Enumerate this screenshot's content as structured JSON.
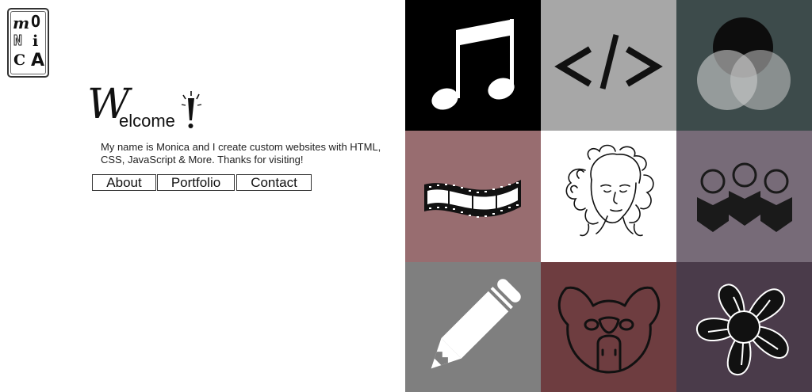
{
  "logo": {
    "letters": [
      "m",
      "O",
      "N",
      "i",
      "C",
      "A"
    ],
    "alt": "MONICA"
  },
  "welcome": {
    "big_letter": "W",
    "rest": "elcome"
  },
  "intro_text": "My name is Monica and I create custom websites with HTML, CSS, JavaScript & More. Thanks for visiting!",
  "nav": {
    "about": "About",
    "portfolio": "Portfolio",
    "contact": "Contact"
  },
  "tiles": [
    {
      "name": "music",
      "icon": "music-note-icon",
      "bg": "#000000"
    },
    {
      "name": "code",
      "icon": "code-icon",
      "bg": "#a7a7a7"
    },
    {
      "name": "design",
      "icon": "venn-circles-icon",
      "bg": "#3d4b4b"
    },
    {
      "name": "film",
      "icon": "film-strip-icon",
      "bg": "#986d70"
    },
    {
      "name": "portrait",
      "icon": "portrait-icon",
      "bg": "#ffffff"
    },
    {
      "name": "people",
      "icon": "people-icon",
      "bg": "#776b78"
    },
    {
      "name": "pencil",
      "icon": "pencil-icon",
      "bg": "#7f7f7f"
    },
    {
      "name": "dog",
      "icon": "dog-icon",
      "bg": "#6e3d40"
    },
    {
      "name": "flower",
      "icon": "flower-icon",
      "bg": "#4a3b4a"
    }
  ],
  "colors": {
    "text": "#222222",
    "border": "#333333"
  }
}
